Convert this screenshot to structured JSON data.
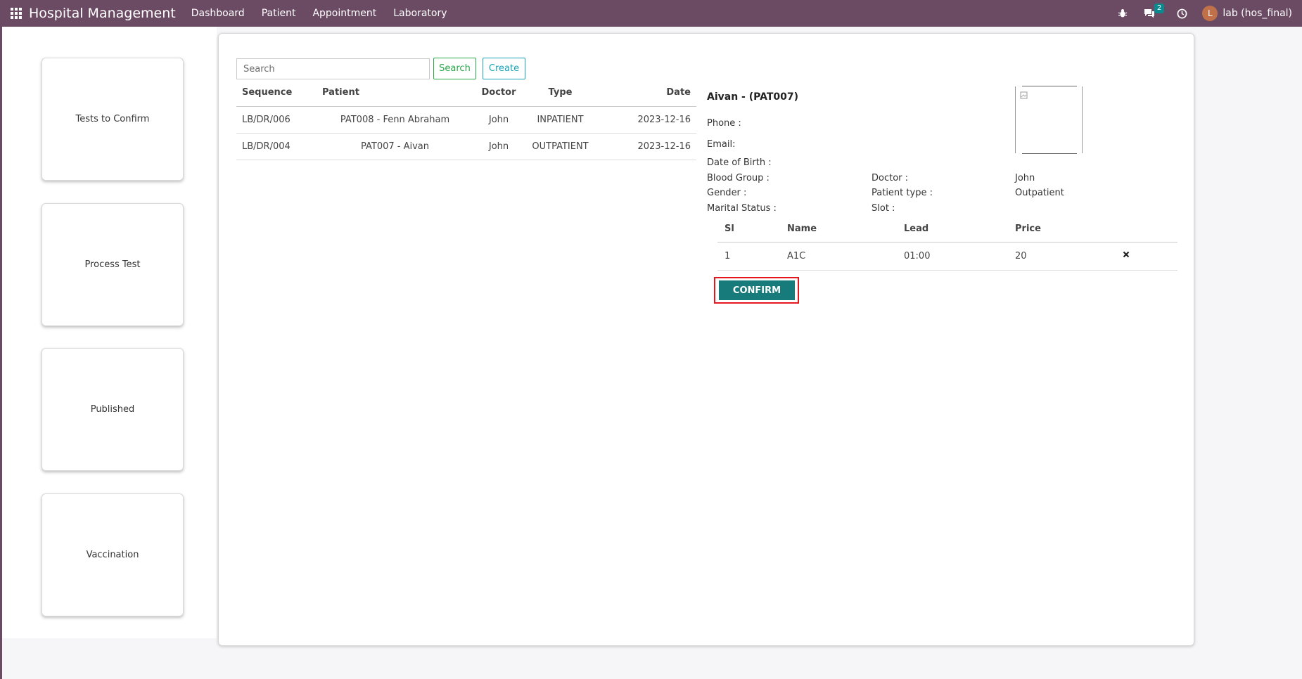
{
  "navbar": {
    "app_title": "Hospital Management",
    "menu": [
      "Dashboard",
      "Patient",
      "Appointment",
      "Laboratory"
    ],
    "chat_count": "2",
    "user_initial": "L",
    "user_name": "lab (hos_final)"
  },
  "sidebar": {
    "cards": [
      "Tests to Confirm",
      "Process Test",
      "Published",
      "Vaccination"
    ]
  },
  "toolbar": {
    "search_placeholder": "Search",
    "search_label": "Search",
    "create_label": "Create"
  },
  "list": {
    "headers": [
      "Sequence",
      "Patient",
      "Doctor",
      "Type",
      "Date"
    ],
    "rows": [
      [
        "LB/DR/006",
        "PAT008 - Fenn Abraham",
        "John",
        "INPATIENT",
        "2023-12-16"
      ],
      [
        "LB/DR/004",
        "PAT007 - Aivan",
        "John",
        "OUTPATIENT",
        "2023-12-16"
      ]
    ]
  },
  "detail": {
    "name": "Aivan - (PAT007)",
    "phone_label": "Phone :",
    "email_label": "Email:",
    "dob_label": "Date of Birth :",
    "blood_label": "Blood Group :",
    "gender_label": "Gender :",
    "marital_label": "Marital Status :",
    "doctor_label": "Doctor :",
    "doctor_value": "John",
    "ptype_label": "Patient type :",
    "ptype_value": "Outpatient",
    "slot_label": "Slot :",
    "tests_headers": [
      "Sl",
      "Name",
      "Lead",
      "Price"
    ],
    "tests": [
      [
        "1",
        "A1C",
        "01:00",
        "20"
      ]
    ],
    "confirm_label": "CONFIRM"
  },
  "colors": {
    "navbar": "#6b4a63",
    "confirm": "#177b7b",
    "search_btn": "#28a745",
    "create_btn": "#17a2b8",
    "highlight": "#e3171d"
  }
}
